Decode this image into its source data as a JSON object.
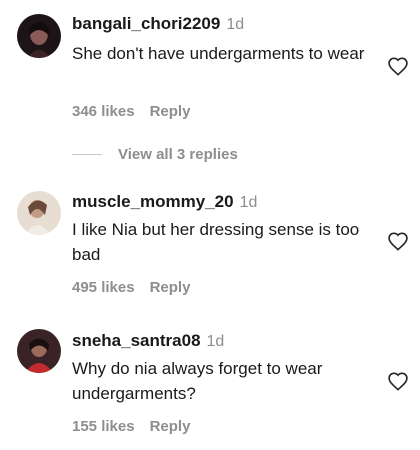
{
  "comments": [
    {
      "username": "bangali_chori2209",
      "time": "1d",
      "text": "She don't have undergarments to wear",
      "likes": "346 likes",
      "reply": "Reply",
      "avatar_colors": [
        "#1d1418",
        "#8a5a58"
      ]
    },
    {
      "username": "muscle_mommy_20",
      "time": "1d",
      "text": "I like Nia but her dressing sense is too bad",
      "likes": "495 likes",
      "reply": "Reply",
      "avatar_colors": [
        "#e8ddd2",
        "#c49b84"
      ]
    },
    {
      "username": "sneha_santra08",
      "time": "1d",
      "text": "Why do nia always forget to wear undergarments?",
      "likes": "155 likes",
      "reply": "Reply",
      "avatar_colors": [
        "#3a2326",
        "#c32b2e"
      ]
    }
  ],
  "view_replies_label": "View all 3 replies",
  "icons": {
    "like": "heart-outline-icon"
  }
}
